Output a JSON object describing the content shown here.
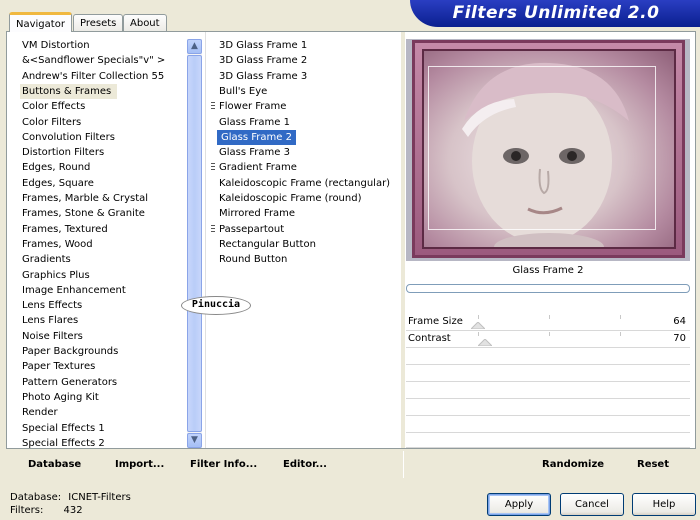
{
  "tabs": [
    "Navigator",
    "Presets",
    "About"
  ],
  "title": "Filters Unlimited 2.0",
  "categories": [
    "VM Distortion",
    "&<Sandflower Specials\"v\" >",
    "Andrew's Filter Collection 55",
    "Buttons & Frames",
    "Color Effects",
    "Color Filters",
    "Convolution Filters",
    "Distortion Filters",
    "Edges, Round",
    "Edges, Square",
    "Frames, Marble & Crystal",
    "Frames, Stone & Granite",
    "Frames, Textured",
    "Frames, Wood",
    "Gradients",
    "Graphics Plus",
    "Image Enhancement",
    "Lens Effects",
    "Lens Flares",
    "Noise Filters",
    "Paper Backgrounds",
    "Paper Textures",
    "Pattern Generators",
    "Photo Aging Kit",
    "Render",
    "Special Effects 1",
    "Special Effects 2"
  ],
  "selected_category": "Buttons & Frames",
  "filters": [
    "3D Glass Frame 1",
    "3D Glass Frame 2",
    "3D Glass Frame 3",
    "Bull's Eye",
    "Flower Frame",
    "Glass Frame 1",
    "Glass Frame 2",
    "Glass Frame 3",
    "Gradient Frame",
    "Kaleidoscopic Frame (rectangular)",
    "Kaleidoscopic Frame (round)",
    "Mirrored Frame",
    "Passepartout",
    "Rectangular Button",
    "Round Button"
  ],
  "selected_filter": "Glass Frame 2",
  "preview_title": "Glass Frame 2",
  "parameters": [
    {
      "label": "Frame Size",
      "value": "64"
    },
    {
      "label": "Contrast",
      "value": "70"
    }
  ],
  "watermark": "Pinuccia",
  "bottom_buttons": {
    "database": "Database",
    "import": "Import...",
    "filter_info": "Filter Info...",
    "editor": "Editor...",
    "randomize": "Randomize",
    "reset": "Reset"
  },
  "status": {
    "database_label": "Database:",
    "database_value": "ICNET-Filters",
    "filters_label": "Filters:",
    "filters_value": "432"
  },
  "dialog_buttons": {
    "apply": "Apply",
    "cancel": "Cancel",
    "help": "Help"
  },
  "colors": {
    "accent": "#316ac5",
    "banner": "#0a1f8f",
    "frame": "#9b5a7d"
  }
}
